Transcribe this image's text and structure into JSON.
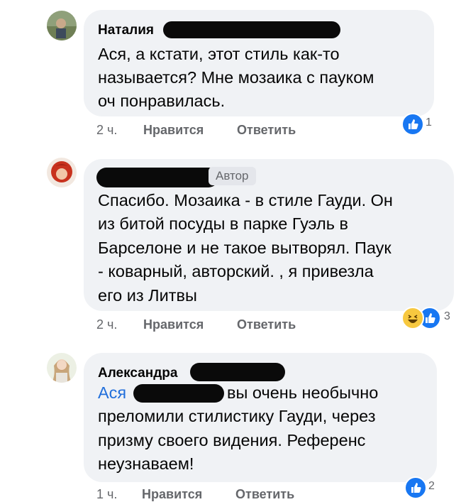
{
  "comments": [
    {
      "author": "Наталия",
      "author_badge": "",
      "lines": [
        "Ася, а кстати, этот стиль как-то",
        "называется? Мне мозаика с пауком",
        "оч понравилась."
      ],
      "time": "2 ч.",
      "like_label": "Нравится",
      "reply_label": "Ответить",
      "reactions": [
        "like-icon"
      ],
      "reaction_count": "1"
    },
    {
      "author": "",
      "author_badge": "Автор",
      "lines": [
        "Спасибо. Мозаика - в стиле Гауди. Он",
        "из битой посуды в парке Гуэль в",
        "Барселоне и не такое вытворял. Паук",
        "- коварный, авторский. , я привезла",
        "его из Литвы"
      ],
      "time": "2 ч.",
      "like_label": "Нравится",
      "reply_label": "Ответить",
      "reactions": [
        "haha-icon",
        "like-icon"
      ],
      "reaction_count": "3"
    },
    {
      "author": "Александра",
      "author_badge": "",
      "mention": "Ася",
      "lines": [
        "вы очень необычно",
        "преломили стилистику Гауди, через",
        "призму своего видения. Референс",
        "неузнаваем!"
      ],
      "time": "1 ч.",
      "like_label": "Нравится",
      "reply_label": "Ответить",
      "reactions": [
        "like-icon"
      ],
      "reaction_count": "2"
    }
  ],
  "colors": {
    "bubble": "#f0f2f5",
    "meta": "#65676b",
    "like": "#1877f2",
    "haha": "#f7c83f",
    "mention": "#216fdb"
  }
}
